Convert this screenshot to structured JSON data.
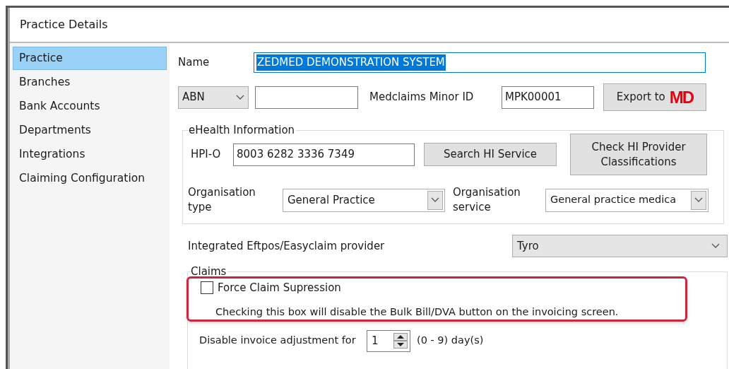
{
  "window": {
    "title": "Practice Details"
  },
  "sidebar": {
    "items": [
      {
        "label": "Practice",
        "selected": true
      },
      {
        "label": "Branches",
        "selected": false
      },
      {
        "label": "Bank Accounts",
        "selected": false
      },
      {
        "label": "Departments",
        "selected": false
      },
      {
        "label": "Integrations",
        "selected": false
      },
      {
        "label": "Claiming Configuration",
        "selected": false
      }
    ]
  },
  "name": {
    "label": "Name",
    "value": "ZEDMED DEMONSTRATION SYSTEM",
    "text_selected": true
  },
  "id_type": {
    "value": "ABN"
  },
  "medclaims": {
    "label": "Medclaims Minor ID",
    "value": "MPK00001"
  },
  "export_button": {
    "label": "Export to",
    "logo": "MD"
  },
  "ehealth": {
    "legend": "eHealth Information",
    "hpio_label": "HPI-O",
    "hpio_value": "8003 6282 3336 7349",
    "search_button": "Search HI Service",
    "check_button": "Check HI Provider Classifications",
    "org_type_label": "Organisation type",
    "org_type_value": "General Practice",
    "org_service_label": "Organisation service",
    "org_service_value": "General practice medica"
  },
  "eftpos": {
    "label": "Integrated Eftpos/Easyclaim provider",
    "value": "Tyro"
  },
  "claims": {
    "legend": "Claims",
    "highlighted": true,
    "force_suppression": {
      "label": "Force Claim Supression",
      "checked": false
    },
    "help_text": "Checking this box will disable the Bulk Bill/DVA button on the invoicing screen.",
    "adjustment_label": "Disable invoice adjustment for",
    "adjustment_value": "1",
    "adjustment_range": "(0 - 9) day(s)"
  }
}
